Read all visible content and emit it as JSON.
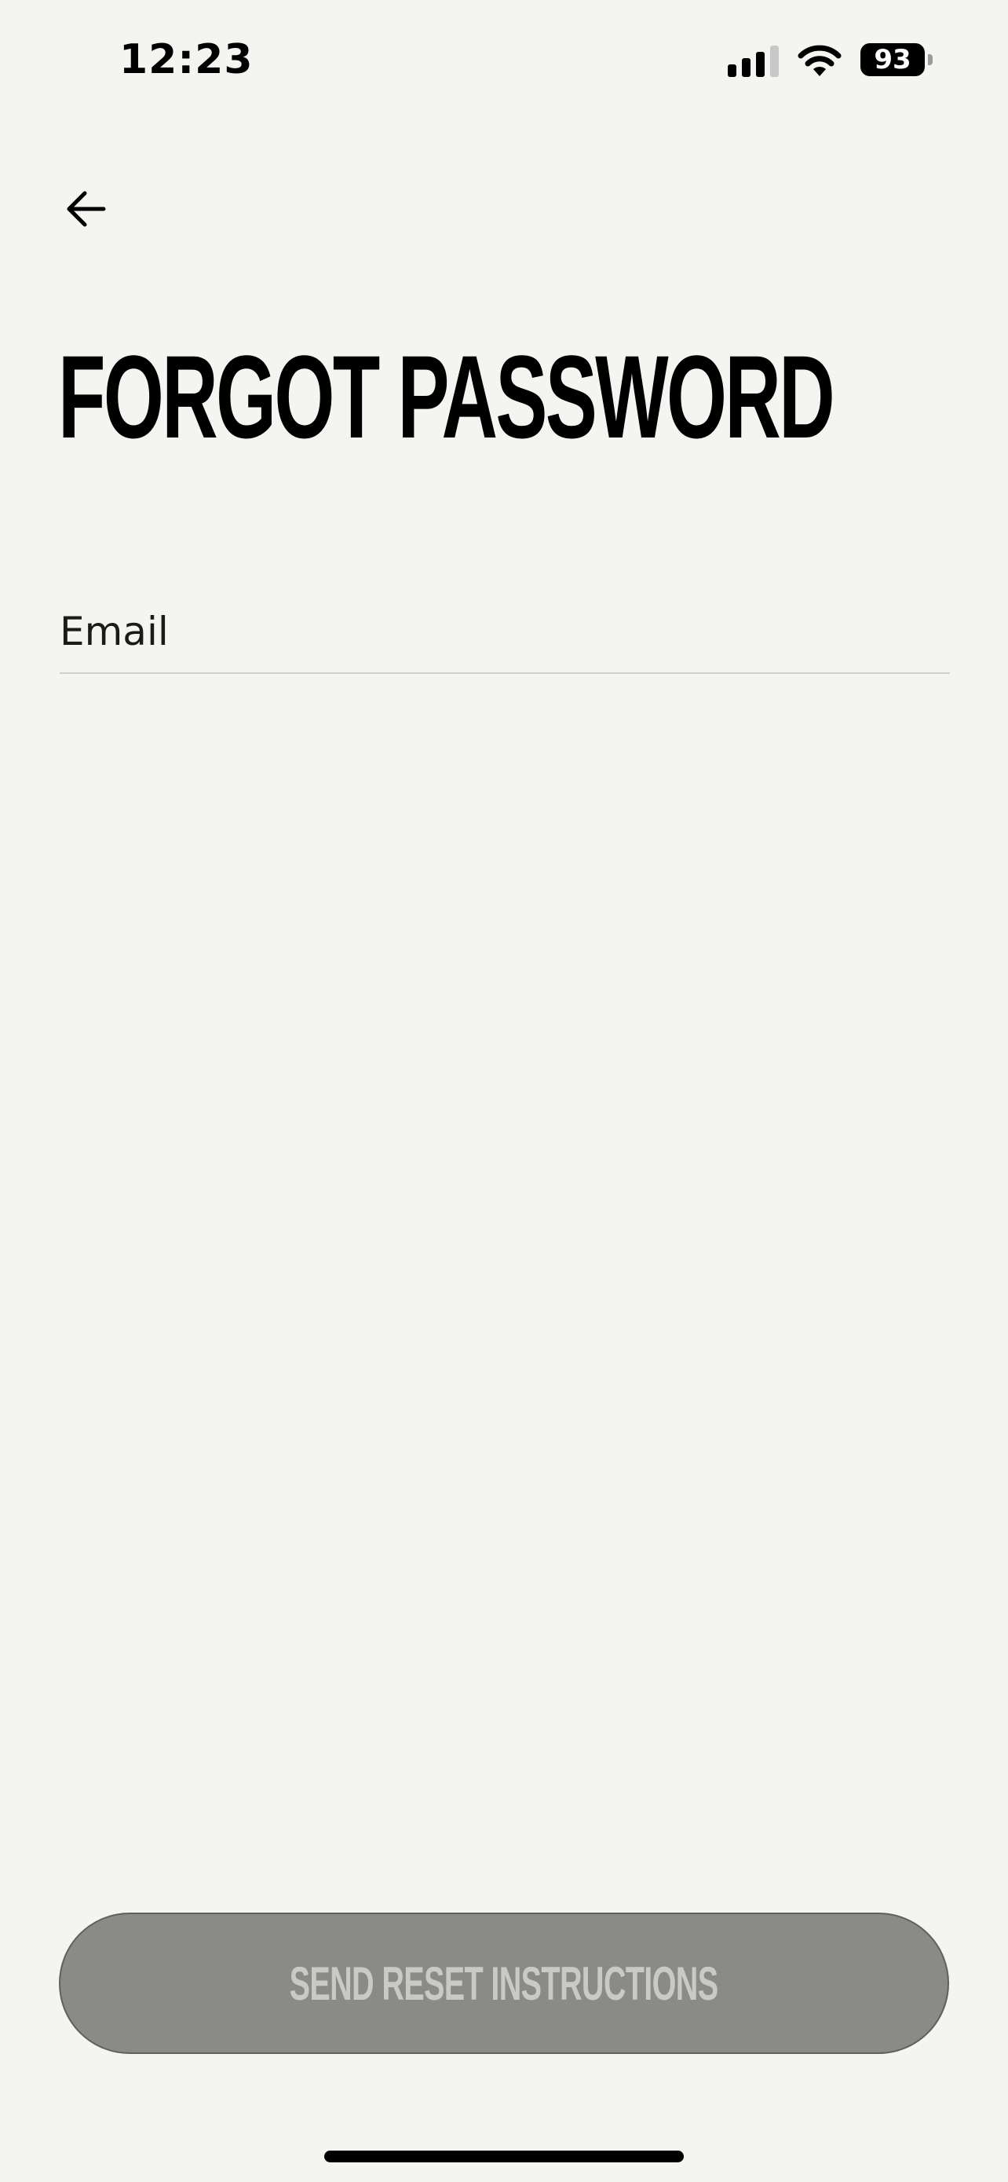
{
  "status_bar": {
    "time": "12:23",
    "battery_level": "93",
    "signal_bars_active": 3,
    "signal_bars_total": 4
  },
  "header": {
    "back_icon": "arrow-left-icon"
  },
  "page": {
    "title": "FORGOT PASSWORD"
  },
  "form": {
    "email_placeholder": "Email",
    "email_value": ""
  },
  "actions": {
    "send_label": "SEND RESET INSTRUCTIONS",
    "send_enabled": false
  },
  "colors": {
    "background": "#f4f4f1",
    "button_disabled": "#8a8a88",
    "button_text_disabled": "#c9c9c7",
    "text": "#000000"
  }
}
